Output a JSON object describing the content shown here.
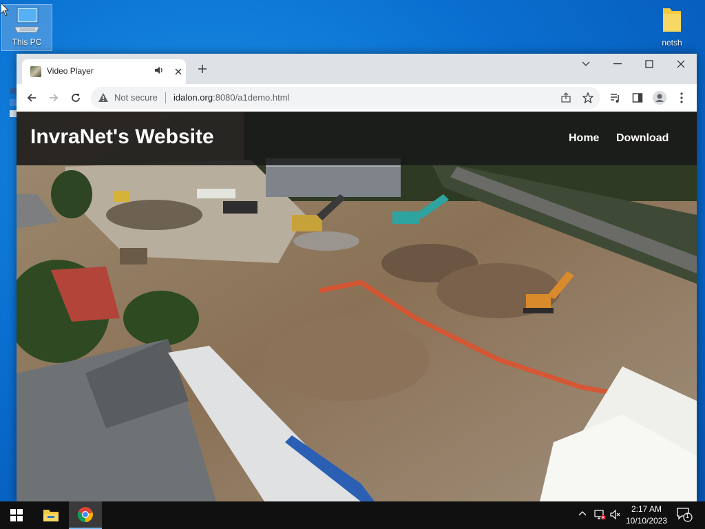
{
  "desktop": {
    "icons": [
      {
        "label": "This PC",
        "icon": "computer-icon"
      },
      {
        "label": "netsh",
        "icon": "folder-icon"
      }
    ]
  },
  "browser": {
    "tab": {
      "title": "Video Player",
      "audio_icon": "speaker-icon",
      "favicon": "video-thumbnail-icon"
    },
    "address": {
      "security": "Not secure",
      "host": "idalon.org",
      "port": ":8080",
      "path": "/a1demo.html"
    }
  },
  "website": {
    "title": "InvraNet's Website",
    "nav": [
      "Home",
      "Download"
    ],
    "video": {
      "subject": "aerial construction site"
    }
  },
  "taskbar": {
    "time": "2:17 AM",
    "date": "10/10/2023",
    "notification_count": "1",
    "pinned": [
      "start-icon",
      "file-explorer-icon",
      "chrome-icon"
    ]
  },
  "colors": {
    "desktop": "#0a6fd0",
    "tabbar": "#dee1e6",
    "header_overlay": "#191919",
    "taskbar": "#101010"
  }
}
